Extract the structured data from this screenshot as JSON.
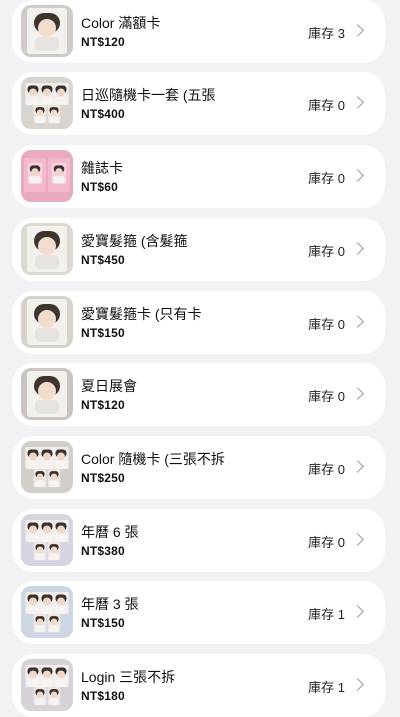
{
  "products": [
    {
      "name": "Color 滿額卡",
      "price": "NT$120",
      "stock": "庫存 3",
      "icon": "photocard-single",
      "tint": "#cfcac6"
    },
    {
      "name": "日巡隨機卡一套 (五張",
      "price": "NT$400",
      "stock": "庫存 0",
      "icon": "photocard-set",
      "tint": "#d9d4cf"
    },
    {
      "name": "雜誌卡",
      "price": "NT$60",
      "stock": "庫存 0",
      "icon": "magazine-card",
      "tint": "#e9a9c0"
    },
    {
      "name": "愛寶髮箍 (含髮箍",
      "price": "NT$450",
      "stock": "庫存 0",
      "icon": "photocard-single",
      "tint": "#dcd8d2"
    },
    {
      "name": "愛寶髮箍卡 (只有卡",
      "price": "NT$150",
      "stock": "庫存 0",
      "icon": "photocard-single",
      "tint": "#d7d2cc"
    },
    {
      "name": "夏日展會",
      "price": "NT$120",
      "stock": "庫存 0",
      "icon": "photocard-single",
      "tint": "#c9c4c2"
    },
    {
      "name": "Color 隨機卡 (三張不拆",
      "price": "NT$250",
      "stock": "庫存 0",
      "icon": "photocard-set",
      "tint": "#d3cec9"
    },
    {
      "name": "年曆 6 張",
      "price": "NT$380",
      "stock": "庫存 0",
      "icon": "photocard-set",
      "tint": "#d8d3e0"
    },
    {
      "name": "年曆 3 張",
      "price": "NT$150",
      "stock": "庫存 1",
      "icon": "photocard-set",
      "tint": "#cfd6e3"
    },
    {
      "name": "Login 三張不拆",
      "price": "NT$180",
      "stock": "庫存 1",
      "icon": "photocard-set",
      "tint": "#d6d2d8"
    }
  ]
}
